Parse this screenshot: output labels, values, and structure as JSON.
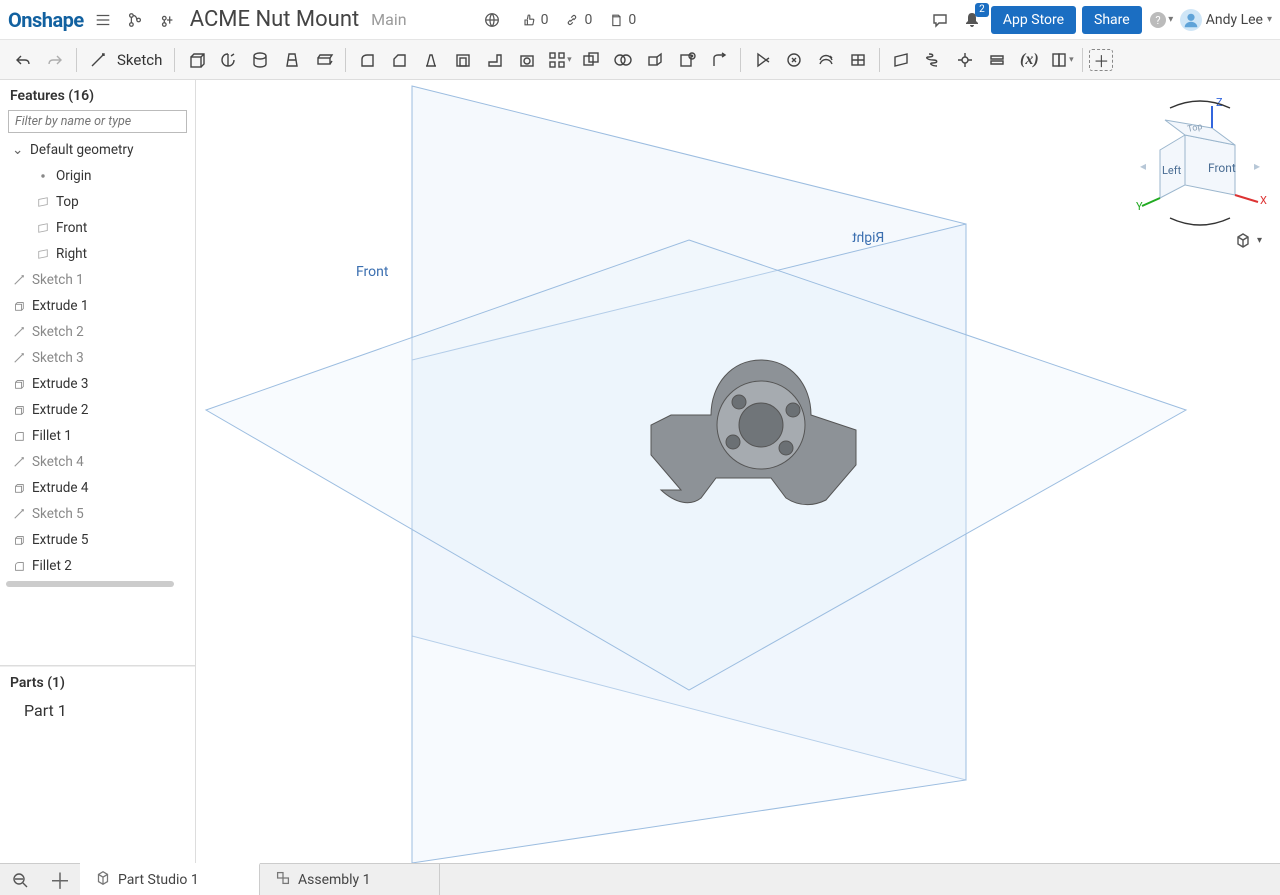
{
  "header": {
    "logo": "Onshape",
    "doc_title": "ACME Nut Mount",
    "branch": "Main",
    "likes": "0",
    "links": "0",
    "copies": "0",
    "notif_badge": "2",
    "app_store": "App Store",
    "share": "Share",
    "user_name": "Andy Lee"
  },
  "toolbar": {
    "sketch_label": "Sketch"
  },
  "features": {
    "header": "Features (16)",
    "filter_placeholder": "Filter by name or type",
    "default_geom": "Default geometry",
    "items": [
      {
        "label": "Origin",
        "icon": "origin",
        "child": true
      },
      {
        "label": "Top",
        "icon": "plane",
        "child": true
      },
      {
        "label": "Front",
        "icon": "plane",
        "child": true
      },
      {
        "label": "Right",
        "icon": "plane",
        "child": true
      },
      {
        "label": "Sketch 1",
        "icon": "sketch",
        "faded": true
      },
      {
        "label": "Extrude 1",
        "icon": "extrude"
      },
      {
        "label": "Sketch 2",
        "icon": "sketch",
        "faded": true
      },
      {
        "label": "Sketch 3",
        "icon": "sketch",
        "faded": true
      },
      {
        "label": "Extrude 3",
        "icon": "extrude"
      },
      {
        "label": "Extrude 2",
        "icon": "extrude"
      },
      {
        "label": "Fillet 1",
        "icon": "fillet"
      },
      {
        "label": "Sketch 4",
        "icon": "sketch",
        "faded": true
      },
      {
        "label": "Extrude 4",
        "icon": "extrude"
      },
      {
        "label": "Sketch 5",
        "icon": "sketch",
        "faded": true
      },
      {
        "label": "Extrude 5",
        "icon": "extrude"
      },
      {
        "label": "Fillet 2",
        "icon": "fillet"
      }
    ]
  },
  "parts": {
    "header": "Parts (1)",
    "items": [
      {
        "label": "Part 1"
      }
    ]
  },
  "canvas": {
    "front_label": "Front",
    "right_label": "Right",
    "cube": {
      "front": "Front",
      "left": "Left",
      "top": "Top",
      "x": "X",
      "y": "Y",
      "z": "Z"
    }
  },
  "tabs": {
    "part_studio": "Part Studio 1",
    "assembly": "Assembly 1"
  }
}
